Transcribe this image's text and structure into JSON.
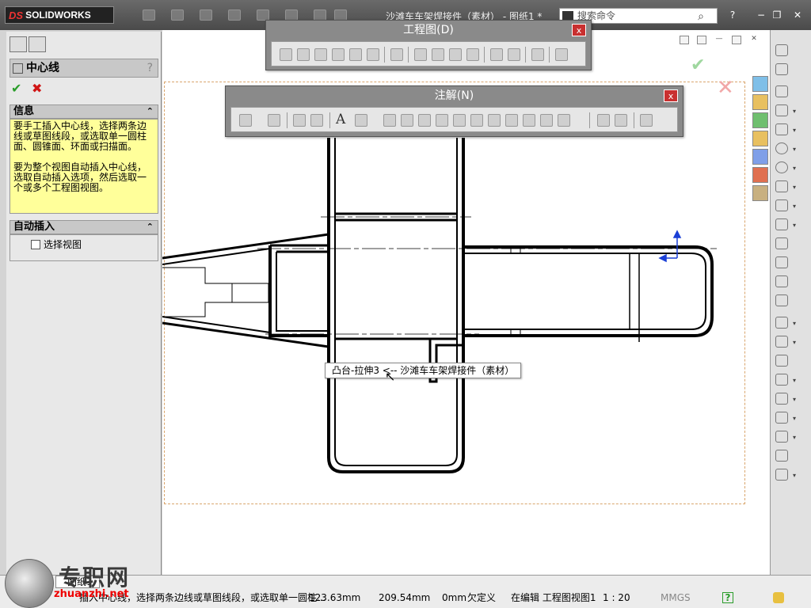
{
  "app": {
    "logo": "SOLIDWORKS",
    "document_title": "沙滩车车架焊接件（素材） - 图纸1 *",
    "search_placeholder": "搜索命令",
    "help": "?",
    "window_controls": {
      "minimize": "−",
      "restore": "❐",
      "close": "✕"
    }
  },
  "property_manager": {
    "title": "中心线",
    "help": "?",
    "ok_icon": "check-icon",
    "cancel_icon": "close-icon",
    "info_section": {
      "title": "信息",
      "paragraphs": [
        "要手工插入中心线，选择两条边线或草图线段，或选取单一圆柱面、圆锥面、环面或扫描面。",
        "要为整个视图自动插入中心线，选取自动插入选项，然后选取一个或多个工程图视图。"
      ]
    },
    "auto_insert_section": {
      "title": "自动插入",
      "checkbox_label": "选择视图",
      "checked": false
    }
  },
  "toolbars": {
    "drawing": {
      "title": "工程图(D)",
      "close": "x"
    },
    "annotation": {
      "title": "注解(N)",
      "close": "x"
    }
  },
  "tooltip": {
    "text": "凸台-拉伸3 <-- 沙滩车车架焊接件（素材）"
  },
  "statusbar": {
    "sheet_tab": "图纸1",
    "message": "插入中心线，选择两条边线或草图线段，或选取单一圆柱...",
    "x": "123.63mm",
    "y": "209.54mm",
    "z": "0mm",
    "status": "欠定义",
    "editing": "在编辑 工程图视图1",
    "scale": "1 : 20",
    "units": "MMGS",
    "help": "?"
  },
  "watermark": {
    "text": "专职网",
    "url": "zhuanzhi.net"
  },
  "colors": {
    "titlebar": "#4a4a4a",
    "info_bg": "#ffff9a",
    "ok": "#2a9d2a",
    "cancel": "#d01515",
    "sheet_border": "#d9a56c"
  }
}
